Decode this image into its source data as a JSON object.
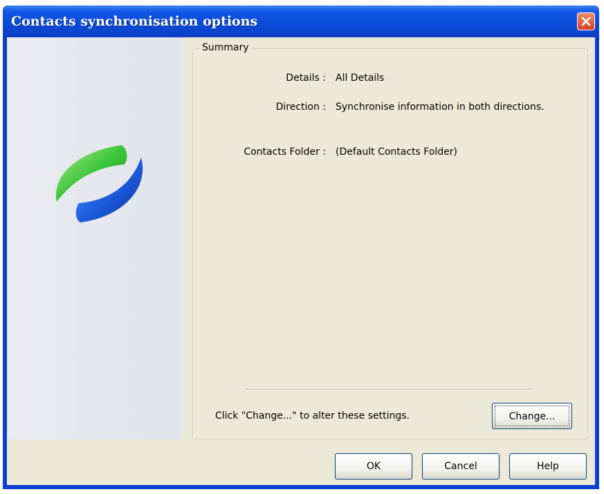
{
  "window": {
    "title": "Contacts synchronisation options"
  },
  "summary": {
    "legend": "Summary",
    "rows": [
      {
        "label": "Details :",
        "value": "All Details"
      },
      {
        "label": "Direction :",
        "value": "Synchronise information in both directions."
      },
      {
        "label": "Contacts Folder :",
        "value": "(Default Contacts Folder)"
      }
    ],
    "hint": "Click \"Change...\" to alter these settings.",
    "change_label": "Change..."
  },
  "buttons": {
    "ok": "OK",
    "cancel": "Cancel",
    "help": "Help"
  },
  "icons": {
    "logo": "sync-arrows-icon",
    "close": "close-icon"
  },
  "colors": {
    "titlebar": "#0a4bd9",
    "client": "#ece9d8",
    "logo_green": "#3cc43c",
    "logo_blue": "#1f5fe0",
    "close_button": "#d5431e"
  }
}
